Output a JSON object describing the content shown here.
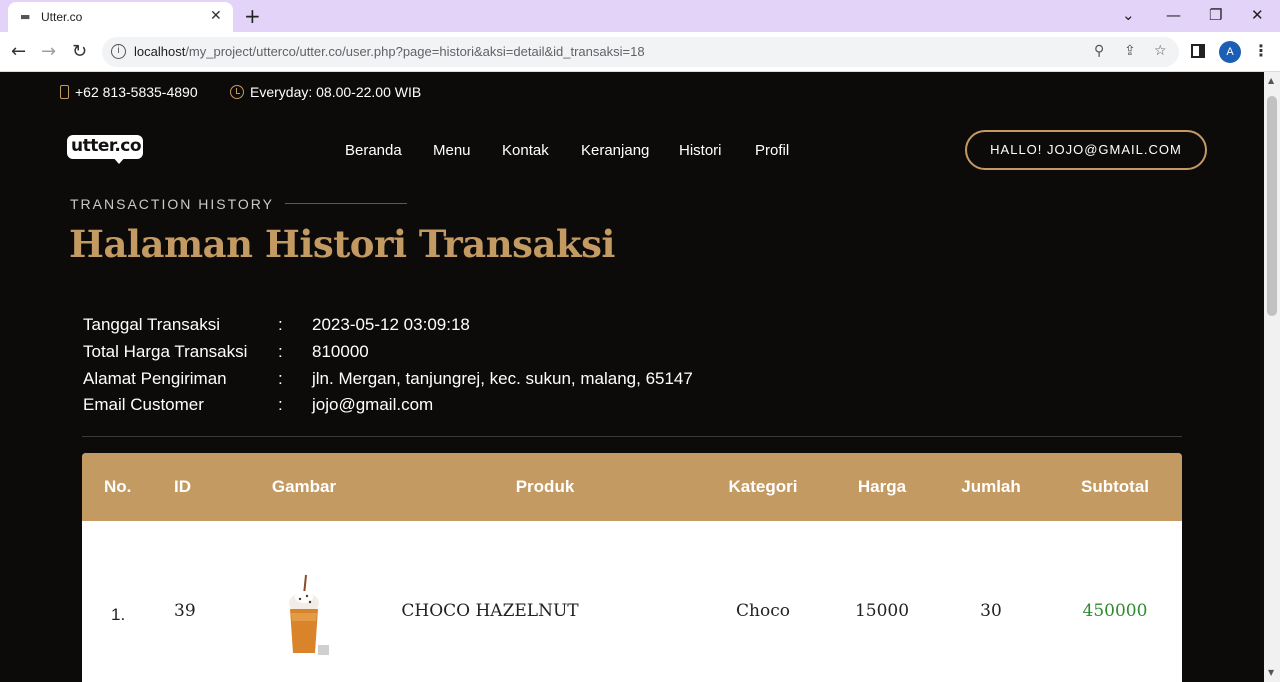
{
  "browser": {
    "tab_title": "Utter.co",
    "url_host": "localhost",
    "url_path": "/my_project/utterco/utter.co/user.php?page=histori&aksi=detail&id_transaksi=18",
    "profile_initial": "A"
  },
  "topbar": {
    "phone": "+62 813-5835-4890",
    "hours": "Everyday: 08.00-22.00 WIB"
  },
  "header": {
    "logo_text": "utter.co",
    "nav": [
      "Beranda",
      "Menu",
      "Kontak",
      "Keranjang",
      "Histori",
      "Profil"
    ],
    "greeting_button": "HALLO! JOJO@GMAIL.COM"
  },
  "hero": {
    "subtitle": "TRANSACTION HISTORY",
    "title": "Halaman Histori Transaksi"
  },
  "details": [
    {
      "label": "Tanggal Transaksi",
      "value": "2023-05-12 03:09:18"
    },
    {
      "label": "Total Harga Transaksi",
      "value": "810000"
    },
    {
      "label": "Alamat Pengiriman",
      "value": "jln. Mergan, tanjungrej, kec. sukun, malang, 65147"
    },
    {
      "label": "Email Customer",
      "value": "jojo@gmail.com"
    }
  ],
  "detail_separator": ":",
  "table": {
    "headers": [
      "No.",
      "ID",
      "Gambar",
      "Produk",
      "Kategori",
      "Harga",
      "Jumlah",
      "Subtotal"
    ],
    "rows": [
      {
        "no": "1.",
        "id": "39",
        "produk": "CHOCO HAZELNUT",
        "kategori": "Choco",
        "harga": "15000",
        "jumlah": "30",
        "subtotal": "450000"
      }
    ]
  },
  "colors": {
    "accent": "#c49a63",
    "background": "#0d0b0a",
    "subtotal": "#2e8b2e"
  }
}
